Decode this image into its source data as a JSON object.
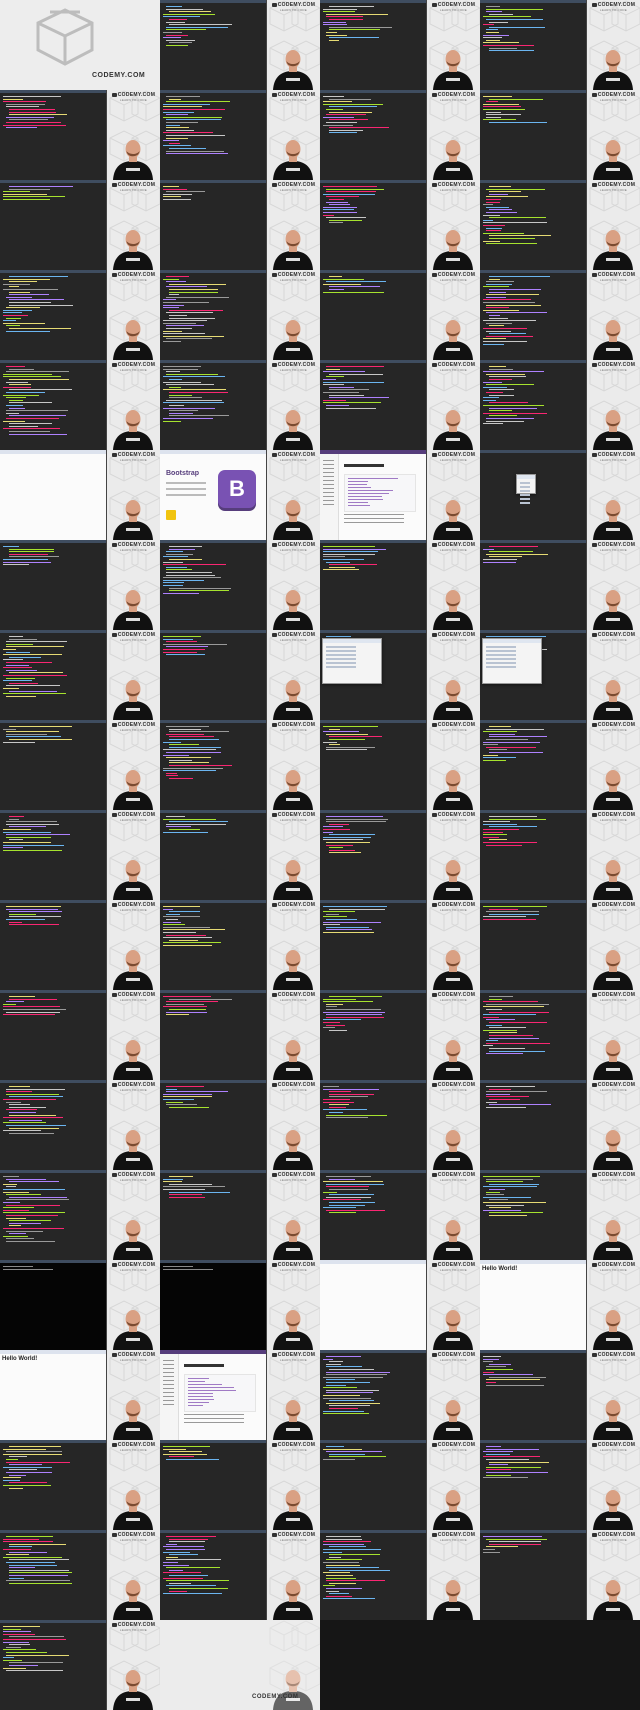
{
  "brand": {
    "name": "CODEMY.COM",
    "tagline": "LEARN TO CODE"
  },
  "intro_frame": {
    "brand_text": "CODEMY.COM"
  },
  "outro_frame": {
    "brand_text": "CODEMY.COM"
  },
  "bootstrap_page": {
    "title": "Bootstrap",
    "logo_letter": "B"
  },
  "hello_page": {
    "heading": "Hello World!"
  },
  "grid": {
    "columns": 4,
    "rows": 19,
    "frames": [
      "intro",
      "editor",
      "editor",
      "editor",
      "editor",
      "editor",
      "editor",
      "editor",
      "editor",
      "editor",
      "editor",
      "editor",
      "editor",
      "editor",
      "editor",
      "editor",
      "editor",
      "editor",
      "editor",
      "editor",
      "browser",
      "bootstrap",
      "doc",
      "dialog-small",
      "editor",
      "editor",
      "editor",
      "editor",
      "editor",
      "editor",
      "dialog",
      "dialog",
      "editor",
      "editor",
      "editor",
      "editor",
      "editor",
      "editor",
      "editor",
      "editor",
      "editor",
      "editor",
      "editor",
      "editor",
      "editor",
      "editor",
      "editor",
      "editor",
      "editor",
      "editor",
      "editor",
      "editor",
      "editor",
      "editor",
      "editor",
      "editor",
      "terminal",
      "terminal",
      "browser",
      "hello",
      "hello",
      "doc",
      "editor",
      "editor",
      "editor",
      "editor",
      "editor",
      "editor",
      "editor",
      "editor",
      "editor",
      "editor",
      "editor",
      "outro",
      "none",
      "none"
    ]
  },
  "colors": {
    "editor_bg": "#262626",
    "code_colors": [
      "#c7c7c7",
      "#6bb5f0",
      "#e6db74",
      "#f92672",
      "#a6e22e",
      "#ae81ff",
      "#9a9a9a"
    ],
    "shirt": "#111111",
    "skin": "#d9a083"
  }
}
